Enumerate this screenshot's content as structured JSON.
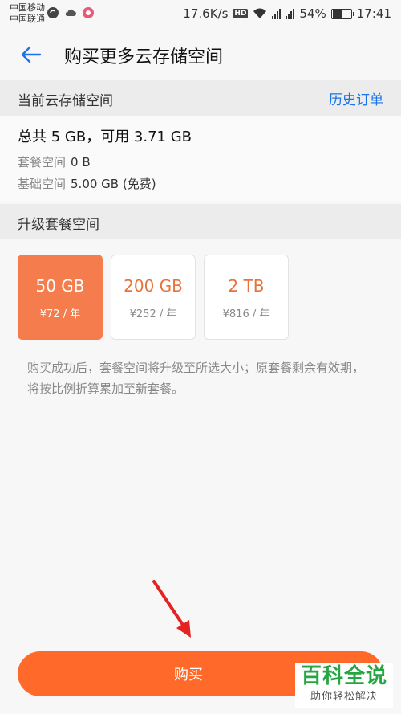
{
  "statusbar": {
    "carrier1": "中国移动",
    "carrier2": "中国联通",
    "speed": "17.6K/s",
    "hd": "HD",
    "battery_text": "54%",
    "battery_level": 0.54,
    "time": "17:41"
  },
  "header": {
    "title": "购买更多云存储空间",
    "back_icon": "arrow-left-icon"
  },
  "current": {
    "heading": "当前云存储空间",
    "history_label": "历史订单",
    "total": "总共 5 GB，可用 3.71 GB",
    "package_key": "套餐空间",
    "package_value": "0 B",
    "base_key": "基础空间",
    "base_value": "5.00 GB (免费)"
  },
  "upgrade": {
    "heading": "升级套餐空间",
    "plans": [
      {
        "size": "50 GB",
        "price": "¥72 / 年",
        "selected": true
      },
      {
        "size": "200 GB",
        "price": "¥252 / 年",
        "selected": false
      },
      {
        "size": "2 TB",
        "price": "¥816 / 年",
        "selected": false
      }
    ],
    "note": "购买成功后，套餐空间将升级至所选大小；原套餐剩余有效期，将按比例折算累加至新套餐。"
  },
  "buy_label": "购买",
  "watermark": {
    "main": "百科全说",
    "sub": "助你轻松解决"
  },
  "colors": {
    "accent": "#ff6a2b",
    "link": "#1a73e8",
    "selected_plan": "#f57c4c",
    "watermark_green": "#26a642"
  }
}
